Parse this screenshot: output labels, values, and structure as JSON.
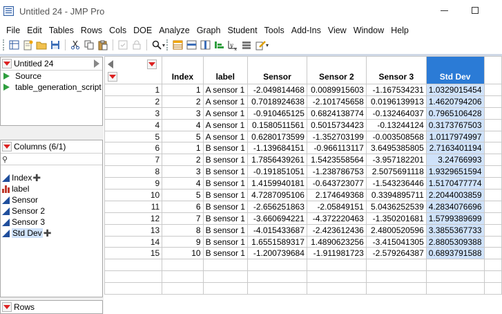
{
  "window": {
    "title": "Untitled 24 - JMP Pro"
  },
  "menu": [
    "File",
    "Edit",
    "Tables",
    "Rows",
    "Cols",
    "DOE",
    "Analyze",
    "Graph",
    "Student",
    "Tools",
    "Add-Ins",
    "View",
    "Window",
    "Help"
  ],
  "toolbar": {
    "icons": [
      "new-data-table-icon",
      "new-script-icon",
      "open-icon",
      "save-icon",
      "cut-icon",
      "copy-icon",
      "paste-icon",
      "disabled-icon",
      "lock-icon",
      "search-icon",
      "data-table-icon",
      "row-icon",
      "col-icon",
      "distribution-icon",
      "fit-y-by-x-icon",
      "fit-model-icon",
      "edit-icon"
    ]
  },
  "table_panel": {
    "name": "Untitled 24",
    "scripts": [
      "Source",
      "table_generation_script"
    ]
  },
  "columns_panel": {
    "header": "Columns (6/1)",
    "columns": [
      {
        "name": "Index",
        "type": "continuous"
      },
      {
        "name": "label",
        "type": "nominal"
      },
      {
        "name": "Sensor",
        "type": "continuous"
      },
      {
        "name": "Sensor 2",
        "type": "continuous"
      },
      {
        "name": "Sensor 3",
        "type": "continuous"
      },
      {
        "name": "Std Dev",
        "type": "continuous",
        "selected": true
      }
    ]
  },
  "rows_panel": {
    "header": "Rows"
  },
  "grid": {
    "headers": [
      "Index",
      "label",
      "Sensor",
      "Sensor 2",
      "Sensor 3",
      "Std Dev"
    ],
    "rows": [
      [
        "1",
        "1",
        "A sensor 1",
        "-2.049814468",
        "0.0089915603",
        "-1.167534231",
        "1.0329015454"
      ],
      [
        "2",
        "2",
        "A sensor 1",
        "0.7018924638",
        "-2.101745658",
        "0.0196139913",
        "1.4620794206"
      ],
      [
        "3",
        "3",
        "A sensor 1",
        "-0.910465125",
        "0.6824138774",
        "-0.132464037",
        "0.7965106428"
      ],
      [
        "4",
        "4",
        "A sensor 1",
        "0.1580511561",
        "0.5015734423",
        "-0.13244124",
        "0.3173767503"
      ],
      [
        "5",
        "5",
        "A sensor 1",
        "0.6280173599",
        "-1.352703199",
        "-0.003508568",
        "1.0117974997"
      ],
      [
        "6",
        "1",
        "B sensor 1",
        "-1.139684151",
        "-0.966113117",
        "3.6495385805",
        "2.7163401194"
      ],
      [
        "7",
        "2",
        "B sensor 1",
        "1.7856439261",
        "1.5423558564",
        "-3.957182201",
        "3.24766993"
      ],
      [
        "8",
        "3",
        "B sensor 1",
        "-0.191851051",
        "-1.238786753",
        "2.5075691118",
        "1.9329651594"
      ],
      [
        "9",
        "4",
        "B sensor 1",
        "1.4159940181",
        "-0.643723077",
        "-1.543236446",
        "1.5170477774"
      ],
      [
        "10",
        "5",
        "B sensor 1",
        "4.7287095106",
        "2.174649368",
        "0.3394895711",
        "2.2044003859"
      ],
      [
        "11",
        "6",
        "B sensor 1",
        "-2.656251863",
        "-2.05849151",
        "5.0436252539",
        "4.2834076696"
      ],
      [
        "12",
        "7",
        "B sensor 1",
        "-3.660694221",
        "-4.372220463",
        "-1.350201681",
        "1.5799389699"
      ],
      [
        "13",
        "8",
        "B sensor 1",
        "-4.015433687",
        "-2.423612436",
        "2.4800520596",
        "3.3855367733"
      ],
      [
        "14",
        "9",
        "B sensor 1",
        "1.6551589317",
        "1.4890623256",
        "-3.415041305",
        "2.8805309388"
      ],
      [
        "15",
        "10",
        "B sensor 1",
        "-1.200739684",
        "-1.911981723",
        "-2.579264387",
        "0.6893791588"
      ]
    ]
  }
}
